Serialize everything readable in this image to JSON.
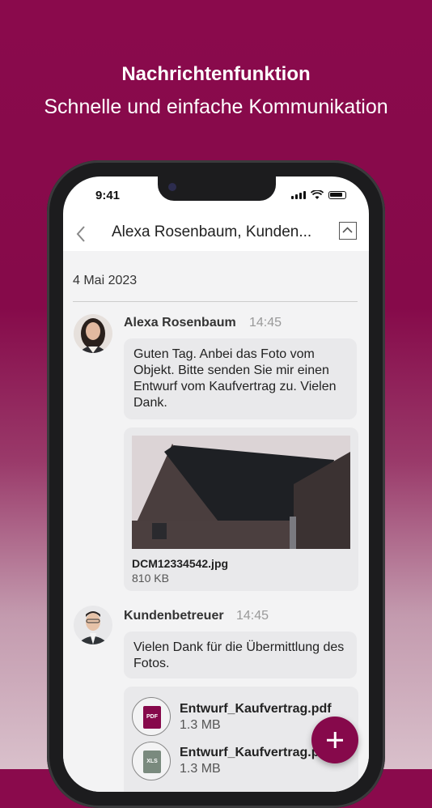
{
  "promo": {
    "title": "Nachrichtenfunktion",
    "subtitle": "Schnelle und einfache Kommunikation"
  },
  "status_bar": {
    "time": "9:41"
  },
  "nav": {
    "title": "Alexa Rosenbaum, Kunden..."
  },
  "thread": {
    "date": "4 Mai 2023",
    "messages": [
      {
        "sender": "Alexa Rosenbaum",
        "time": "14:45",
        "text": "Guten Tag. Anbei das Foto vom Objekt. Bitte senden Sie mir einen Entwurf vom Kaufvertrag zu. Vielen Dank.",
        "attachment": {
          "name": "DCM12334542.jpg",
          "size": "810 KB"
        }
      },
      {
        "sender": "Kundenbetreuer",
        "time": "14:45",
        "text": "Vielen Dank für die Übermittlung des Fotos.",
        "files": [
          {
            "name": "Entwurf_Kaufvertrag.pdf",
            "size": "1.3 MB",
            "icon": "PDF"
          },
          {
            "name": "Entwurf_Kaufvertrag.pdf",
            "size": "1.3 MB",
            "icon": "XLS"
          }
        ]
      }
    ]
  },
  "colors": {
    "brand": "#86094b"
  }
}
